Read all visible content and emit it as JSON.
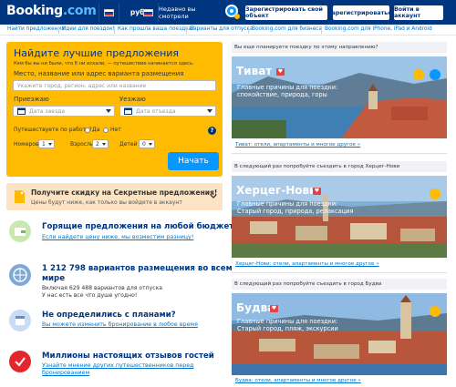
{
  "header": {
    "logo_text": "Booking",
    "logo_suffix": ".com",
    "currency": "руб.",
    "recently_viewed": "Недавно вы смотрели",
    "register_property": "Зарегистрировать свой объект",
    "register": "Зарегистрироваться",
    "sign_in": "Войти в аккаунт"
  },
  "nav": [
    "Найти предложения",
    "Идеи для поездок!",
    "Как прошла ваша поездка?",
    "Варианты для отпуска",
    "Booking.com для бизнеса",
    "Booking.com для iPhone, iPad и Android"
  ],
  "search": {
    "title": "Найдите лучшие предложения",
    "subtitle": "Кем бы вы ни были, что б ни искали, — путешествие начинается здесь.",
    "place_label": "Место, название или адрес варианта размещения",
    "place_placeholder": "Укажите город, регион, адрес или название",
    "checkin_label": "Приезжаю",
    "checkin_placeholder": "Дата заезда",
    "checkout_label": "Уезжаю",
    "checkout_placeholder": "Дата отъезда",
    "work_label": "Путешествуете по работе?",
    "yes": "Да",
    "no": "Нет",
    "rooms_label": "Номеров",
    "rooms_value": "1",
    "adults_label": "Взрослых",
    "adults_value": "2",
    "children_label": "Детей",
    "children_value": "0",
    "submit": "Начать"
  },
  "secret": {
    "title": "Получите скидку на Секретные предложения!",
    "subtitle": "Цены будут ниже, как только вы войдете в аккаунт"
  },
  "features": [
    {
      "title": "Горящие предложения на любой бюджет",
      "link": "Если найдете цену ниже, мы возместим разницу!"
    },
    {
      "title": "1 212 798 вариантов размещения во всем",
      "title2": "мире",
      "line1": "Включая 629 488 вариантов для отпуска",
      "line2": "У нас есть все что душе угодно!"
    },
    {
      "title": "Не определились с планами?",
      "link": "Вы можете изменить бронирование в любое время"
    },
    {
      "title": "Миллионы настоящих отзывов гостей",
      "link": "Узнайте мнение других путешественников перед",
      "link2": "бронированием"
    }
  ],
  "right": {
    "where_head": "Вы еще планируете поездку по этому направлению?",
    "try_head_1": "В следующий раз попробуйте съездить в город Херцег-Нови",
    "try_head_2": "В следующий раз попробуйте съездить в город Будва",
    "reasons": "Главные причины для поездки:",
    "destinations": [
      {
        "name": "Тиват",
        "reasons": "спокойствие, природа, горы",
        "link": "Тиват: отели, апартаменты и многое другое »"
      },
      {
        "name": "Херцег-Нови",
        "reasons": "Старый город, природа, релаксация",
        "link": "Херцег-Нови: отели, апартаменты и многое другое »"
      },
      {
        "name": "Будва",
        "reasons": "Старый город, пляж, экскурсии",
        "link": "Будва: отели, апартаменты и многое другое »"
      }
    ]
  },
  "colors": {
    "header": "#003580",
    "search_bg": "#febb02",
    "button": "#0896ff",
    "link": "#0071c2",
    "secret_bg": "#fbe3c4"
  }
}
